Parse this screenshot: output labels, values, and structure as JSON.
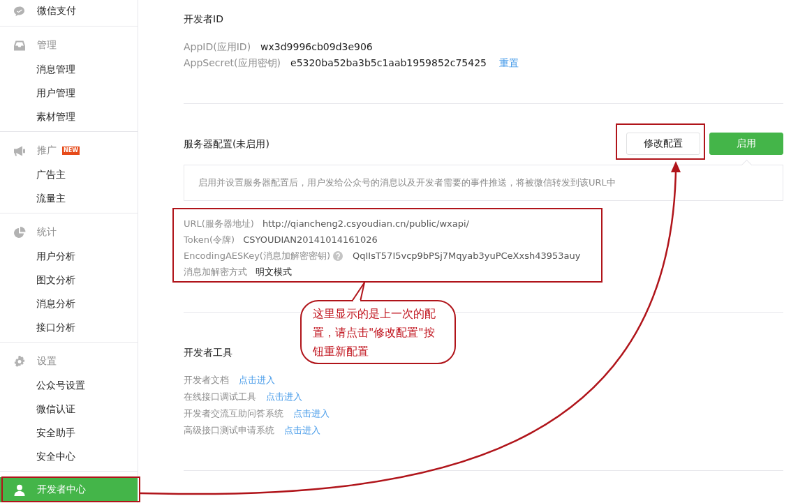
{
  "sidebar": {
    "groups": [
      {
        "title": "微信支付",
        "selected": false
      },
      {
        "title": "管理",
        "selected": false,
        "items": [
          {
            "label": "消息管理",
            "selected": false
          },
          {
            "label": "用户管理",
            "selected": false
          },
          {
            "label": "素材管理",
            "selected": false
          }
        ]
      },
      {
        "title": "推广",
        "badge": "NEW",
        "selected": false,
        "items": [
          {
            "label": "广告主",
            "selected": false
          },
          {
            "label": "流量主",
            "selected": false
          }
        ]
      },
      {
        "title": "统计",
        "selected": false,
        "items": [
          {
            "label": "用户分析",
            "selected": false
          },
          {
            "label": "图文分析",
            "selected": false
          },
          {
            "label": "消息分析",
            "selected": false
          },
          {
            "label": "接口分析",
            "selected": false
          }
        ]
      },
      {
        "title": "设置",
        "selected": false,
        "items": [
          {
            "label": "公众号设置",
            "selected": false
          },
          {
            "label": "微信认证",
            "selected": false
          },
          {
            "label": "安全助手",
            "selected": false
          },
          {
            "label": "安全中心",
            "selected": false
          }
        ]
      },
      {
        "title": "开发者中心",
        "selected": true
      }
    ]
  },
  "developer_id": {
    "title": "开发者ID",
    "rows": [
      {
        "label": "AppID(应用ID)",
        "value": "wx3d9996cb09d3e906"
      },
      {
        "label": "AppSecret(应用密钥)",
        "value": "e5320ba52ba3b5c1aab1959852c75425",
        "link": "重置"
      }
    ]
  },
  "server_config": {
    "title": "服务器配置(未启用)",
    "buttons": [
      {
        "label": "修改配置",
        "kind": "default"
      },
      {
        "label": "启用",
        "kind": "primary"
      }
    ],
    "info": "启用并设置服务器配置后，用户发给公众号的消息以及开发者需要的事件推送，将被微信转发到该URL中",
    "rows": [
      {
        "label": "URL(服务器地址)",
        "value": "http://qiancheng2.csyoudian.cn/public/wxapi/"
      },
      {
        "label": "Token(令牌)",
        "value": "CSYOUDIAN20141014161026"
      },
      {
        "label": "EncodingAESKey(消息加解密密钥)",
        "value": "QqIIsT57I5vcp9bPSj7Mqyab3yuPCeXxsh43953auy",
        "help": true
      },
      {
        "label": "消息加解密方式",
        "value": "明文模式"
      }
    ]
  },
  "developer_tools": {
    "title": "开发者工具",
    "rows": [
      {
        "label": "开发者文档",
        "link": "点击进入"
      },
      {
        "label": "在线接口调试工具",
        "link": "点击进入"
      },
      {
        "label": "开发者交流互助问答系统",
        "link": "点击进入"
      },
      {
        "label": "高级接口测试申请系统",
        "link": "点击进入"
      }
    ]
  },
  "annotation": {
    "callout": "这里显示的是上一次的配置，请点击\"修改配置\"按钮重新配置"
  }
}
